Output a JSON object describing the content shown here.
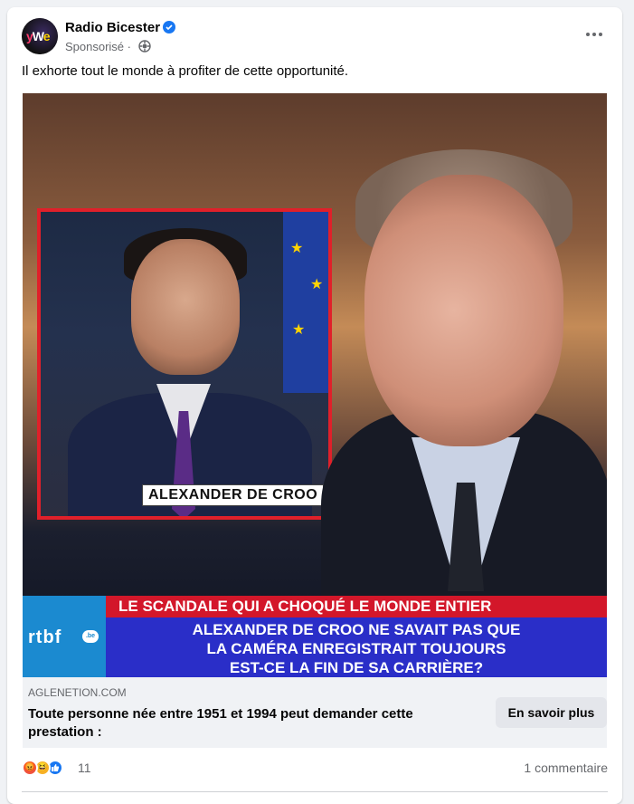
{
  "post": {
    "page_name": "Radio Bicester",
    "sponsored": "Sponsorisé",
    "separator": "·",
    "caption": "Il exhorte tout le monde à profiter de cette opportunité.",
    "avatar_logo": "yWe"
  },
  "image": {
    "name_label": "ALEXANDER DE CROO",
    "ticker_red": "LE SCANDALE QUI A CHOQUÉ LE MONDE ENTIER",
    "ticker_lines": [
      "ALEXANDER DE CROO NE SAVAIT PAS QUE",
      "LA CAMÉRA ENREGISTRAIT TOUJOURS",
      "EST-CE LA FIN DE SA CARRIÈRE?"
    ],
    "channel_logo": "rtbf",
    "channel_suffix": ".be"
  },
  "link": {
    "domain": "AGLENETION.COM",
    "headline": "Toute personne née entre 1951 et 1994 peut demander cette prestation :",
    "cta": "En savoir plus"
  },
  "stats": {
    "reaction_count": "11",
    "comments": "1 commentaire",
    "reactions": [
      "angry",
      "haha",
      "like"
    ]
  },
  "colors": {
    "verified": "#1877f2",
    "ticker_red": "#d3172a",
    "ticker_blue": "#2a2ec8",
    "rtbf_blue": "#1b8ad0"
  }
}
